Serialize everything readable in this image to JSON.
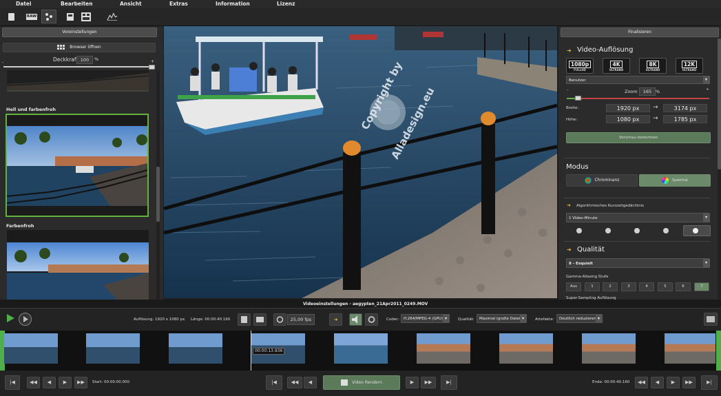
{
  "menu": [
    "Datei",
    "Bearbeiten",
    "Ansicht",
    "Extras",
    "Information",
    "Lizenz"
  ],
  "toolbar": {
    "icons": [
      "new-document-icon",
      "raw-icon",
      "effects-icon",
      "save-icon",
      "save-as-icon",
      "histogram-icon"
    ],
    "raw_label": "RAW"
  },
  "left": {
    "header": "Voreinstellungen",
    "browser_button": "Browser öffnen",
    "opacity_label": "Deckkraft",
    "opacity_value": "100",
    "opacity_unit": "%",
    "opacity_level": 1.0,
    "slider_min": "-",
    "slider_max": "+",
    "presets": [
      {
        "label": "Hell und farbenfroh",
        "selected": true
      },
      {
        "label": "Farbenfroh",
        "selected": false
      }
    ]
  },
  "watermark": {
    "line1": "Copyright by",
    "line2": "Alladesign.eu"
  },
  "right": {
    "header": "Finalisieren",
    "resolution_title": "Video-Auflösung",
    "resolutions": [
      {
        "top": "1080p",
        "sub": "FULLHD"
      },
      {
        "top": "4K",
        "sub": "ULTRAND"
      },
      {
        "top": "8K",
        "sub": "ULTRAND"
      },
      {
        "top": "12K",
        "sub": "ULTRAND"
      }
    ],
    "preset_dropdown": "Benutzer",
    "zoom_label": "Zoom",
    "zoom_value": "165",
    "zoom_unit": "%",
    "width_label": "Breite:",
    "width_from": "1920 px",
    "width_to": "3174 px",
    "height_label": "Höhe:",
    "height_from": "1080 px",
    "height_to": "1785 px",
    "arrow": "→",
    "preview_button": "Vorschau berechnen",
    "mode_title": "Modus",
    "mode_chrominanz": "Chrominanz",
    "mode_spektral": "Spektral",
    "memory_label": "Algorithmisches Kurzzeitgedächtnis",
    "memory_dropdown": "1 Video-Minute",
    "quality_title": "Qualität",
    "quality_dropdown": "8 - Exquisit",
    "gamma_label": "Gamma-Aliasing Stufe",
    "gamma_options": [
      "Aus",
      "1",
      "2",
      "3",
      "4",
      "5",
      "6",
      "7"
    ],
    "gamma_selected": "7",
    "supersampling_label": "Super-Sampling Auflösung"
  },
  "bottom": {
    "title": "Videoeinstellungen - aegypten_21Apr2011_0249.MOV",
    "resolution": "Auflösung: 1920 x 1080 px",
    "length": "Länge: 00:00:40.160",
    "fps": "25,00 fps",
    "codec_label": "Codec:",
    "codec_value": "H.264/MPEG-4 (GPU)",
    "quality_label": "Qualität:",
    "quality_value": "Maximal (große Datei)",
    "artifacts_label": "Artefakte:",
    "artifacts_value": "Deutlich reduzieren",
    "timecode": "00:00:13.936",
    "start": "Start: 00:00:00.000",
    "end": "Ende: 00:00:40.160",
    "render_button": "Video Rendern"
  },
  "colors": {
    "accent_green": "#5fae3c",
    "panel": "#2b2b2b",
    "selection": "#63b43d"
  }
}
